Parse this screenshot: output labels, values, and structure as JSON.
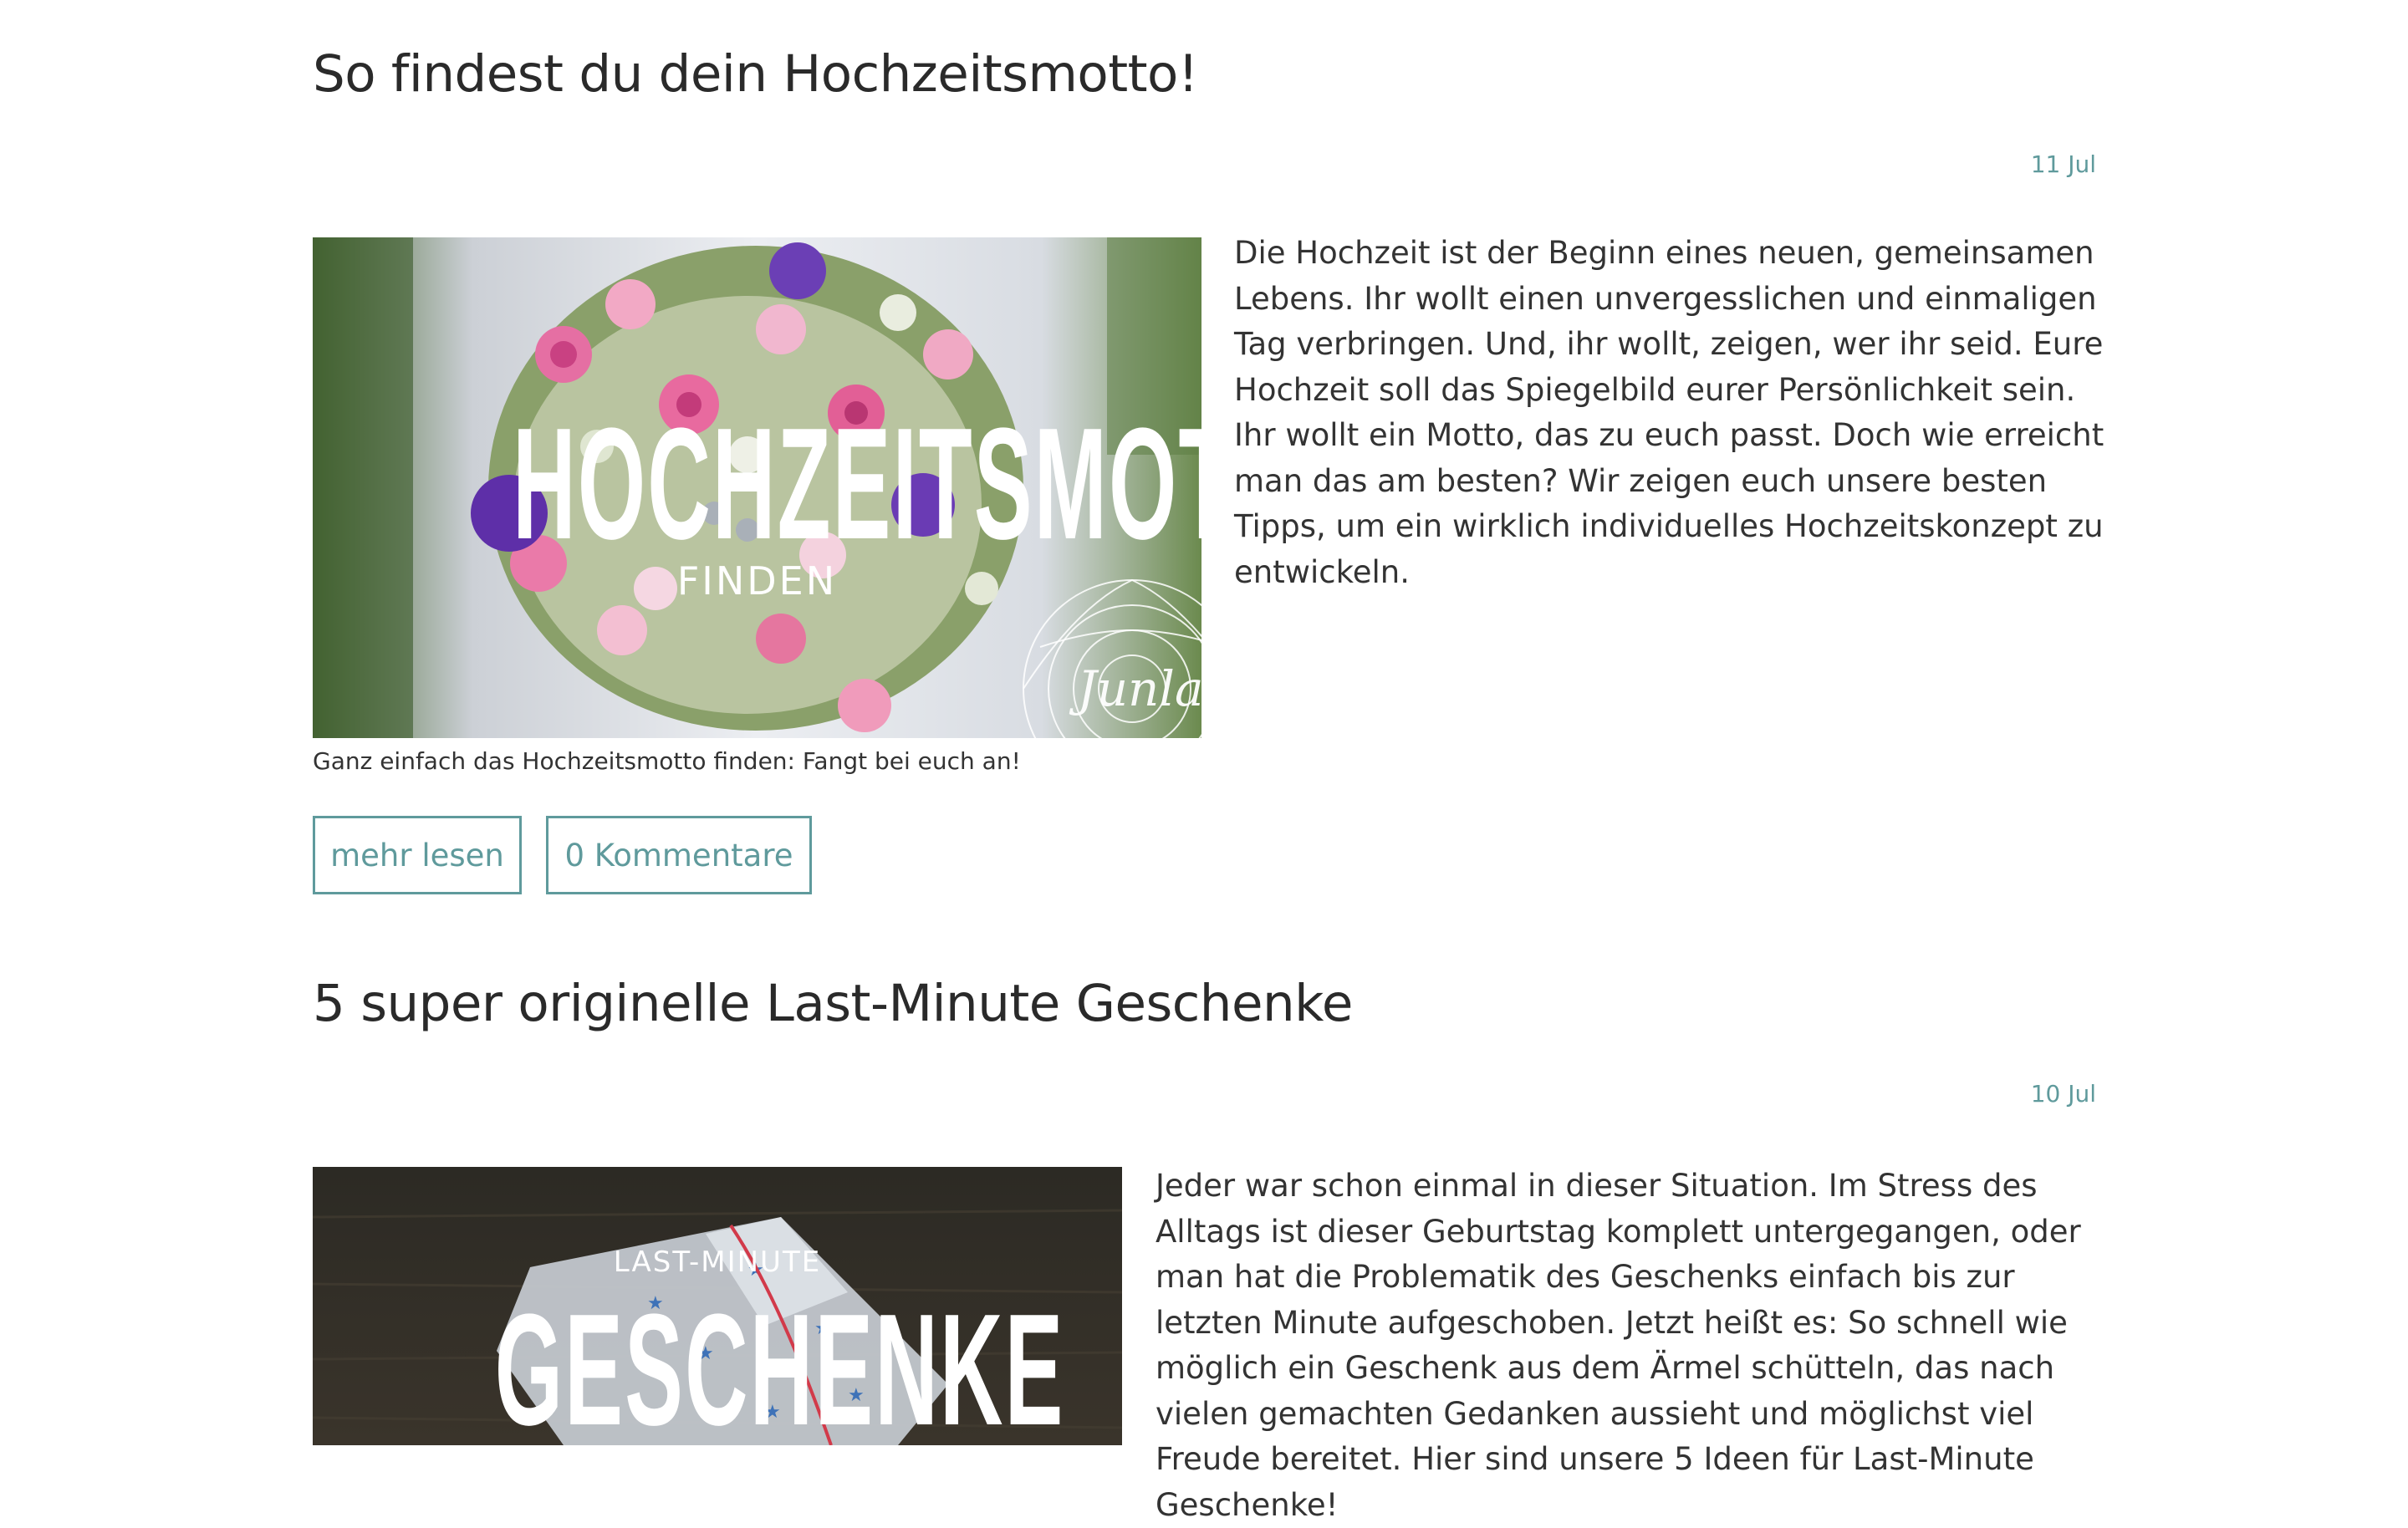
{
  "posts": [
    {
      "title": "So findest du dein Hochzeitsmotto!",
      "date": "11 Jul",
      "image": {
        "headline": "HOCHZEITSMOTTO",
        "subline": "FINDEN",
        "signature": "Junla"
      },
      "caption": "Ganz einfach das Hochzeitsmotto finden: Fangt bei euch an!",
      "excerpt": "Die Hochzeit ist der Beginn eines neuen, gemeinsamen Lebens. Ihr wollt einen unvergesslichen und einmaligen Tag verbringen. Und, ihr wollt, zeigen, wer ihr seid. Eure Hochzeit soll das Spiegelbild eurer Persönlichkeit sein. Ihr wollt ein Motto, das zu euch passt. Doch wie erreicht man das am besten? Wir zeigen euch unsere besten Tipps, um ein wirklich individuelles Hochzeitskonzept zu entwickeln.",
      "read_more_label": "mehr lesen",
      "comments_label": "0 Kommentare"
    },
    {
      "title": "5 super originelle Last-Minute Geschenke",
      "date": "10 Jul",
      "image": {
        "kicker": "LAST-MINUTE",
        "headline": "GESCHENKE"
      },
      "excerpt": "Jeder war schon einmal in dieser Situation. Im Stress des Alltags ist dieser Geburtstag komplett untergegangen, oder man hat die Problematik des Geschenks einfach bis zur letzten Minute aufgeschoben. Jetzt heißt es: So schnell wie möglich ein Geschenk aus dem Ärmel schütteln, das nach vielen gemachten Gedanken aussieht und möglichst viel Freude bereitet. Hier sind unsere 5 Ideen für Last-Minute Geschenke!"
    }
  ],
  "colors": {
    "accent": "#5f9a9c",
    "text": "#2b2b2b"
  },
  "icons": [
    "mandala-ornament",
    "flower-bouquet",
    "gift-package"
  ]
}
